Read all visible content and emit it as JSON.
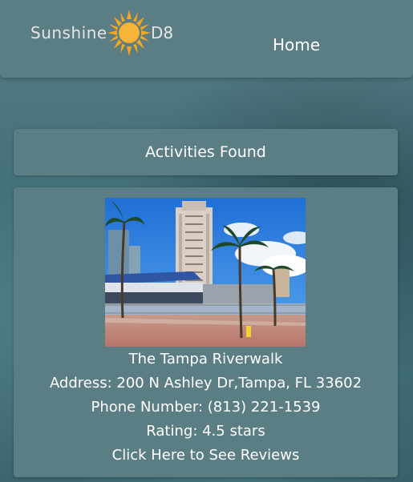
{
  "brand": {
    "logo_left": "Sunshine",
    "logo_right": "D8",
    "sun_color": "#f5a623"
  },
  "nav": {
    "home_label": "Home"
  },
  "results": {
    "heading": "Activities Found"
  },
  "activity": {
    "photo_icon": "photo-of-riverwalk",
    "name": "The Tampa Riverwalk",
    "address": "Address: 200 N Ashley Dr,Tampa, FL 33602",
    "phone": "Phone Number: (813) 221-1539",
    "rating": "Rating: 4.5 stars",
    "reviews_link": "Click Here to See Reviews"
  }
}
